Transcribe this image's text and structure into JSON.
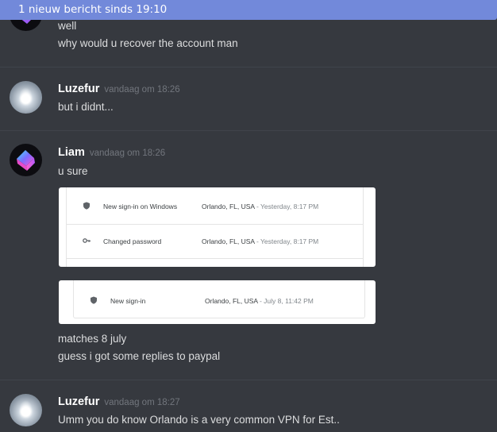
{
  "banner": {
    "text": "1 nieuw bericht sinds 19:10"
  },
  "messages": [
    {
      "lines": [
        "well",
        "why would u recover the account man"
      ]
    },
    {
      "author": "Luzefur",
      "timestamp": "vandaag om 18:26",
      "lines": [
        "but i didnt..."
      ]
    },
    {
      "author": "Liam",
      "timestamp": "vandaag om 18:26",
      "lines": [
        "u sure"
      ]
    },
    {
      "lines": [
        "matches 8 july",
        "guess i got some replies to paypal"
      ]
    },
    {
      "author": "Luzefur",
      "timestamp": "vandaag om 18:27",
      "lines": [
        "Umm you do know Orlando is a very common VPN for Est.."
      ]
    }
  ],
  "attachments": [
    {
      "rows": [
        {
          "icon": "shield-icon",
          "event": "New sign-in on Windows",
          "location": "Orlando, FL, USA",
          "when": " - Yesterday, 8:17 PM"
        },
        {
          "icon": "key-icon",
          "event": "Changed password",
          "location": "Orlando, FL, USA",
          "when": " - Yesterday, 8:17 PM"
        }
      ]
    },
    {
      "rows": [
        {
          "icon": "shield-icon",
          "event": "New sign-in",
          "location": "Orlando, FL, USA",
          "when": " - July 8, 11:42 PM"
        }
      ]
    }
  ],
  "colors": {
    "background": "#36393f",
    "banner": "#7289da",
    "timestamp": "#72767d"
  }
}
